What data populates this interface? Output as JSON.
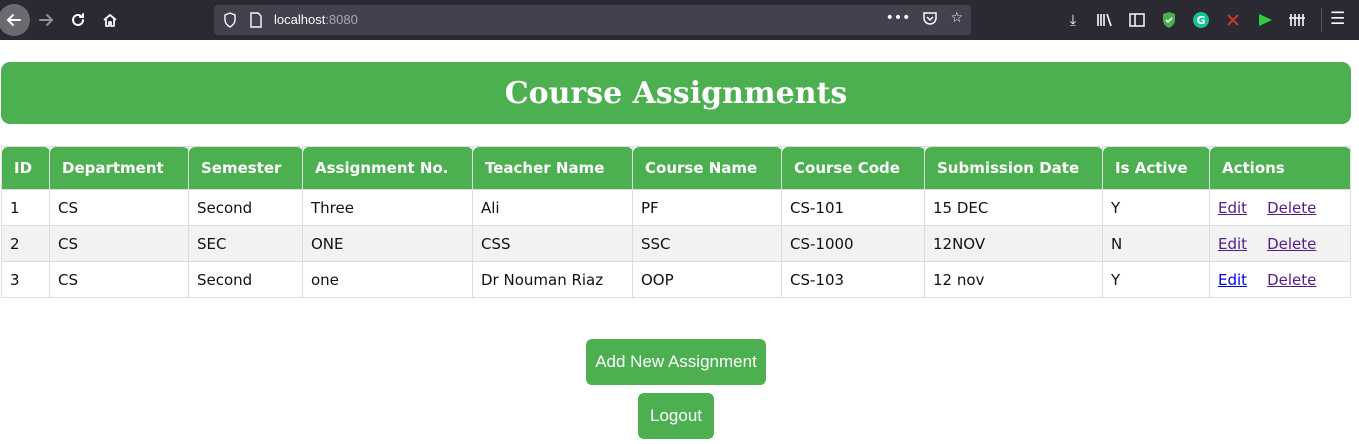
{
  "browser": {
    "url_host": "localhost",
    "url_port": ":8080"
  },
  "page": {
    "title": "Course Assignments"
  },
  "table": {
    "headers": [
      "ID",
      "Department",
      "Semester",
      "Assignment No.",
      "Teacher Name",
      "Course Name",
      "Course Code",
      "Submission Date",
      "Is Active",
      "Actions"
    ],
    "rows": [
      [
        "1",
        "CS",
        "Second",
        "Three",
        "Ali",
        "PF",
        "CS-101",
        "15 DEC",
        "Y"
      ],
      [
        "2",
        "CS",
        "SEC",
        "ONE",
        "CSS",
        "SSC",
        "CS-1000",
        "12NOV",
        "N"
      ],
      [
        "3",
        "CS",
        "Second",
        "one",
        "Dr Nouman Riaz",
        "OOP",
        "CS-103",
        "12 nov",
        "Y"
      ]
    ],
    "edit_label": "Edit",
    "delete_label": "Delete"
  },
  "buttons": {
    "add_label": "Add New Assignment",
    "logout_label": "Logout"
  },
  "colors": {
    "accent": "#4caf50",
    "toolbar": "#2b2a33",
    "visited_link": "#551a8b",
    "link": "#0000ee"
  },
  "icons": {
    "toolbar": [
      "back-icon",
      "forward-icon",
      "reload-icon",
      "home-icon"
    ],
    "urlbar": [
      "shield-icon",
      "page-icon",
      "more-icon",
      "pocket-icon",
      "star-icon"
    ],
    "extensions": [
      "download-icon",
      "library-icon",
      "sidebar-icon",
      "shield-extension-icon",
      "grammarly-icon",
      "blocked-extension-icon",
      "flag-extension-icon",
      "bars-extension-icon",
      "menu-icon"
    ]
  }
}
